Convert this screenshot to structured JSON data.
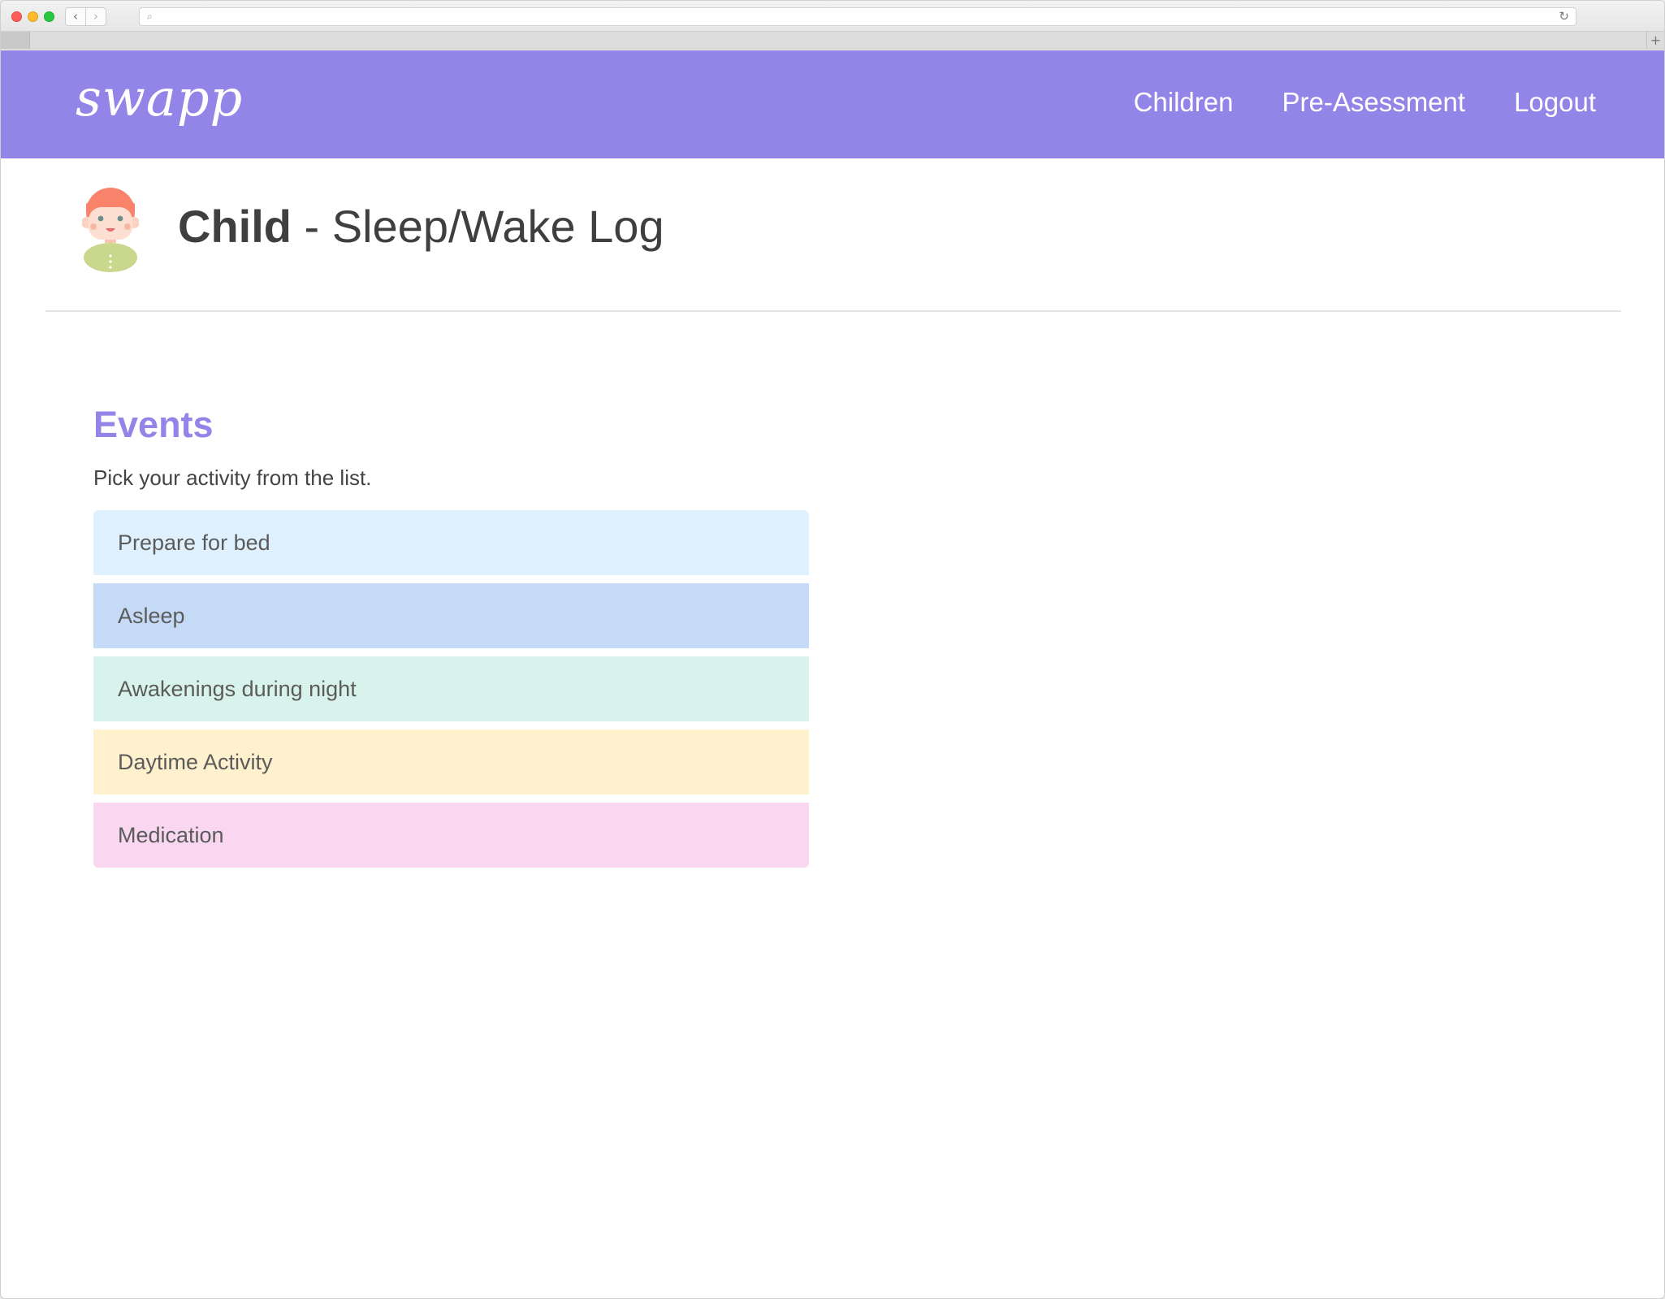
{
  "browser": {
    "back_glyph": "‹",
    "forward_glyph": "›",
    "search_glyph": "⌕",
    "reload_glyph": "↻",
    "new_tab_glyph": "+"
  },
  "header": {
    "logo": "swapp",
    "nav": [
      {
        "label": "Children"
      },
      {
        "label": "Pre-Asessment"
      },
      {
        "label": "Logout"
      }
    ],
    "background": "#9385e8"
  },
  "page": {
    "title_strong": "Child",
    "title_rest": " - Sleep/Wake Log"
  },
  "events": {
    "heading": "Events",
    "instruction": "Pick your activity from the list.",
    "items": [
      {
        "label": "Prepare for bed",
        "color": "#dff0fe"
      },
      {
        "label": "Asleep",
        "color": "#c5daf6"
      },
      {
        "label": "Awakenings during night",
        "color": "#d8f3eb"
      },
      {
        "label": "Daytime Activity",
        "color": "#fff0ce"
      },
      {
        "label": "Medication",
        "color": "#f9d7f1"
      }
    ]
  }
}
